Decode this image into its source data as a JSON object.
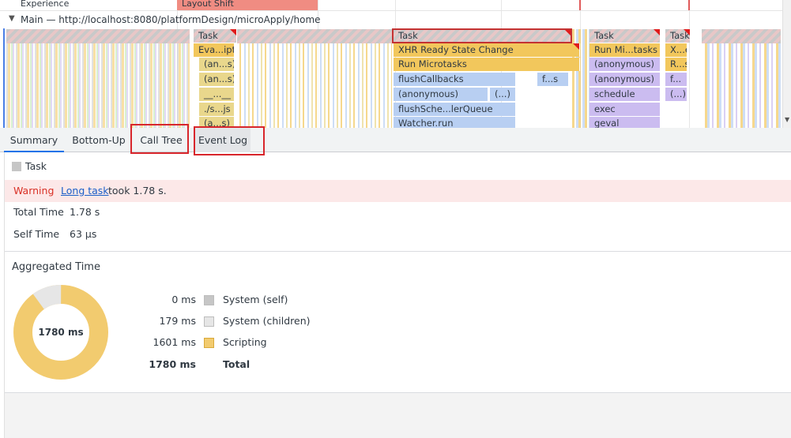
{
  "flame": {
    "experience_label": "Experience",
    "layout_shift_label": "Layout Shift",
    "main_thread_label": "Main — http://localhost:8080/platformDesign/microApply/home",
    "row1": {
      "task_a": "Task",
      "task_b": "Task",
      "task_c": "Task",
      "task_d": "Task"
    },
    "row2": {
      "a": "Eva...ipt",
      "b": "XHR Ready State Change",
      "c": "Run Mi...tasks",
      "d": "X...e"
    },
    "row3": {
      "a": "(an...s)",
      "b": "Run Microtasks",
      "c": "(anonymous)",
      "d": "R...s"
    },
    "row4": {
      "a": "(an...s)",
      "b": "flushCallbacks",
      "b2": "f...s",
      "c": "(anonymous)",
      "d": "f..."
    },
    "row5": {
      "a": "__...__",
      "b": "(anonymous)",
      "b2": "(...)",
      "c": "schedule",
      "d": "(...)"
    },
    "row6": {
      "a": "./s...js",
      "b": "flushSche...lerQueue",
      "c": "exec"
    },
    "row7": {
      "a": "(a...s)",
      "b": "Watcher.run",
      "c": "geval"
    }
  },
  "tabs": [
    {
      "label": "Summary",
      "active": true
    },
    {
      "label": "Bottom-Up"
    },
    {
      "label": "Call Tree"
    },
    {
      "label": "Event Log"
    }
  ],
  "summary": {
    "title": "Task",
    "warning_label": "Warning",
    "warning_link": "Long task",
    "warning_text": "took 1.78 s.",
    "total_time_label": "Total Time",
    "total_time_value": "1.78 s",
    "self_time_label": "Self Time",
    "self_time_value": "63 µs",
    "aggregated_title": "Aggregated Time",
    "donut_center": "1780 ms",
    "legend": [
      {
        "value": "0 ms",
        "label": "System (self)",
        "color": "#c6c6c6"
      },
      {
        "value": "179 ms",
        "label": "System (children)",
        "color": "#e6e6e6"
      },
      {
        "value": "1601 ms",
        "label": "Scripting",
        "color": "#f2cb6f"
      },
      {
        "value": "1780 ms",
        "label": "Total",
        "bold": true
      }
    ]
  },
  "colors": {
    "scripting": "#f2cb6f",
    "system_children": "#e6e6e6",
    "warning_bg": "#fce8e8",
    "highlight": "#d8262c"
  }
}
